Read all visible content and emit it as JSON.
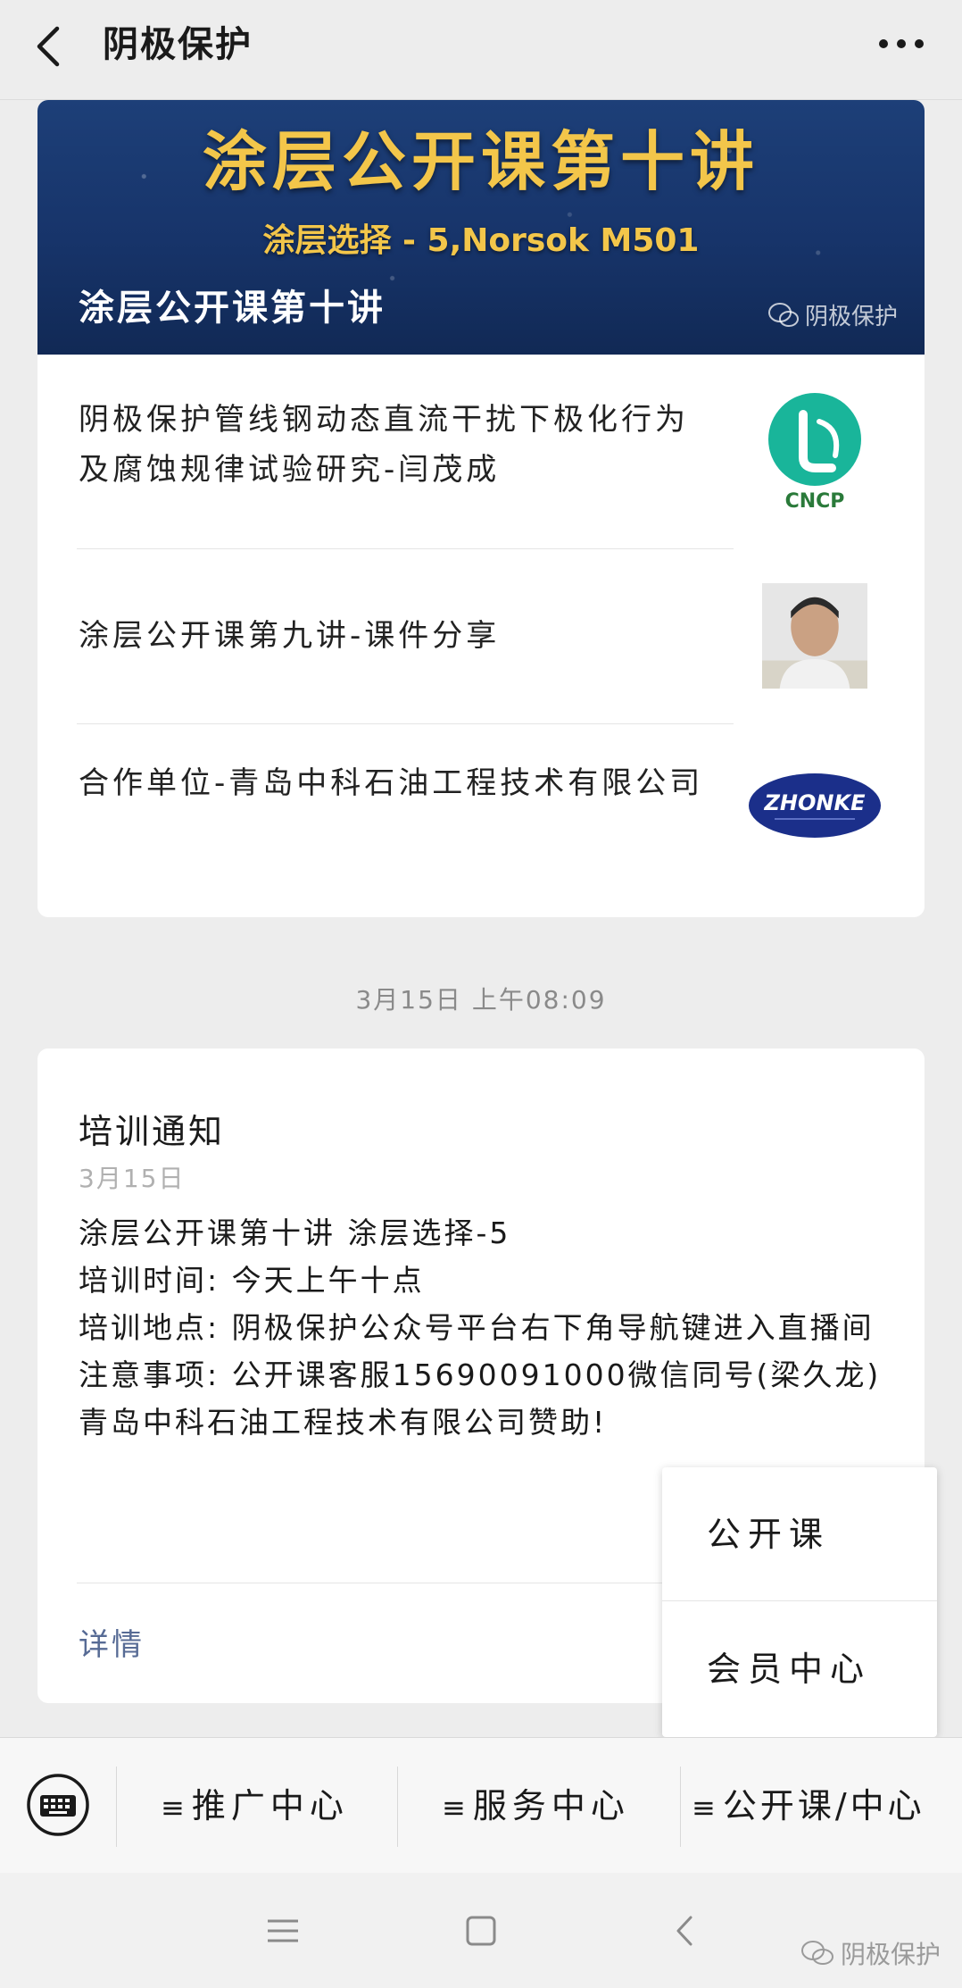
{
  "header": {
    "title": "阴极保护"
  },
  "banner": {
    "main_text": "涂层公开课第十讲",
    "sub_text": "涂层选择 - 5,Norsok M501",
    "caption": "涂层公开课第十讲",
    "watermark": "阴极保护"
  },
  "articles": [
    {
      "title": "阴极保护管线钢动态直流干扰下极化行为及腐蚀规律试验研究-闫茂成",
      "thumb_text": "CNCP"
    },
    {
      "title": "涂层公开课第九讲-课件分享"
    },
    {
      "title": "合作单位-青岛中科石油工程技术有限公司",
      "thumb_text": "ZHONKE"
    }
  ],
  "timestamp": "3月15日 上午08:09",
  "notice": {
    "title": "培训通知",
    "date": "3月15日",
    "lines": [
      "涂层公开课第十讲 涂层选择-5",
      "培训时间: 今天上午十点",
      "培训地点: 阴极保护公众号平台右下角导航键进入直播间",
      "注意事项: 公开课客服15690091000微信同号(梁久龙)",
      "青岛中科石油工程技术有限公司赞助!"
    ],
    "details_label": "详情"
  },
  "popup_menu": {
    "items": [
      "公开课",
      "会员中心"
    ]
  },
  "bottom_menu": {
    "items": [
      "推广中心",
      "服务中心",
      "公开课/中心"
    ]
  },
  "system_nav": {
    "watermark": "阴极保护"
  },
  "colors": {
    "link": "#576b95",
    "banner_bg": "#1d3f78",
    "banner_text": "#f3c64a"
  }
}
